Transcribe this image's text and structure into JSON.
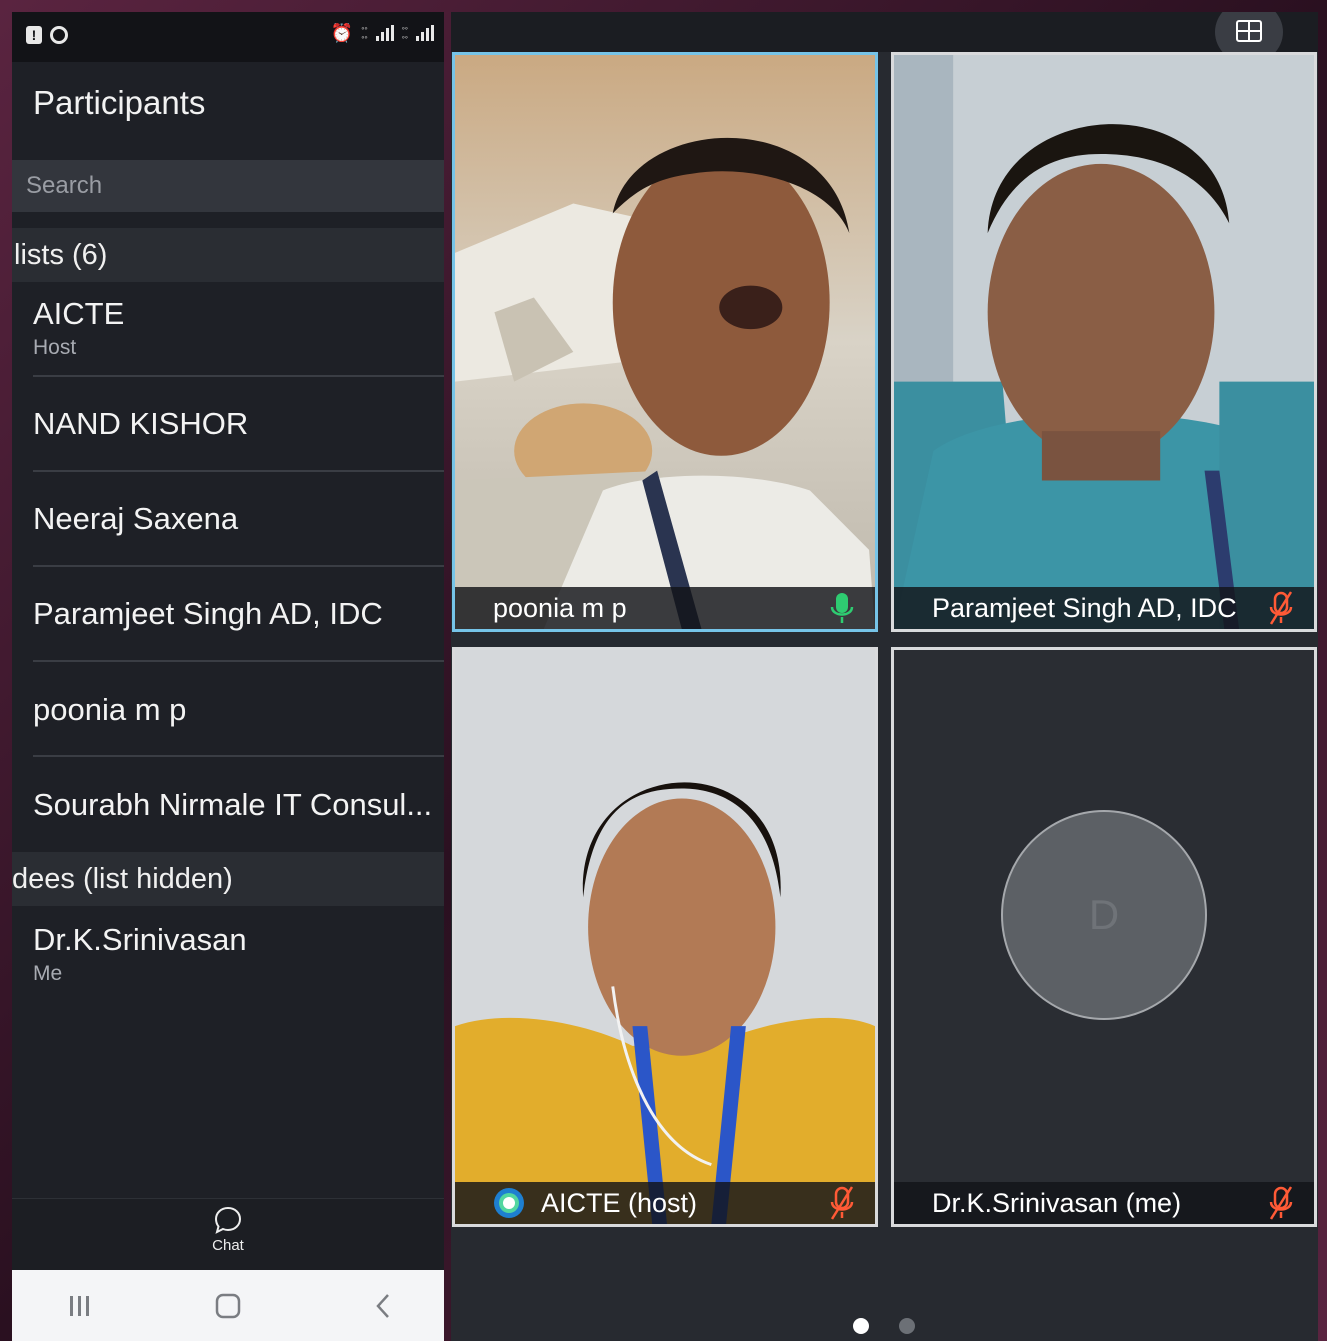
{
  "panel": {
    "title": "Participants",
    "search_placeholder": "Search"
  },
  "sections": {
    "panelists_header": "lists (6)",
    "attendees_header": "dees (list hidden)"
  },
  "panelists": [
    {
      "name": "AICTE",
      "role": "Host"
    },
    {
      "name": "NAND KISHOR"
    },
    {
      "name": "Neeraj Saxena"
    },
    {
      "name": "Paramjeet Singh AD, IDC"
    },
    {
      "name": "poonia m p"
    },
    {
      "name": "Sourabh Nirmale IT Consul..."
    }
  ],
  "attendees": [
    {
      "name": "Dr.K.Srinivasan",
      "role": "Me"
    }
  ],
  "bottom_bar": {
    "chat_label": "Chat"
  },
  "video_tiles": [
    {
      "name": "poonia m p",
      "mic": "on",
      "active": true
    },
    {
      "name": "Paramjeet Singh AD, IDC",
      "mic": "muted"
    },
    {
      "name": "AICTE (host)",
      "mic": "muted",
      "host": true
    },
    {
      "name": "Dr.K.Srinivasan (me)",
      "mic": "muted",
      "avatar_letter": "D"
    }
  ],
  "pager": {
    "current": 1,
    "total": 2
  },
  "colors": {
    "active_border": "#76c4e8",
    "mic_on": "#2ecc71",
    "mic_muted": "#ff5a36"
  }
}
